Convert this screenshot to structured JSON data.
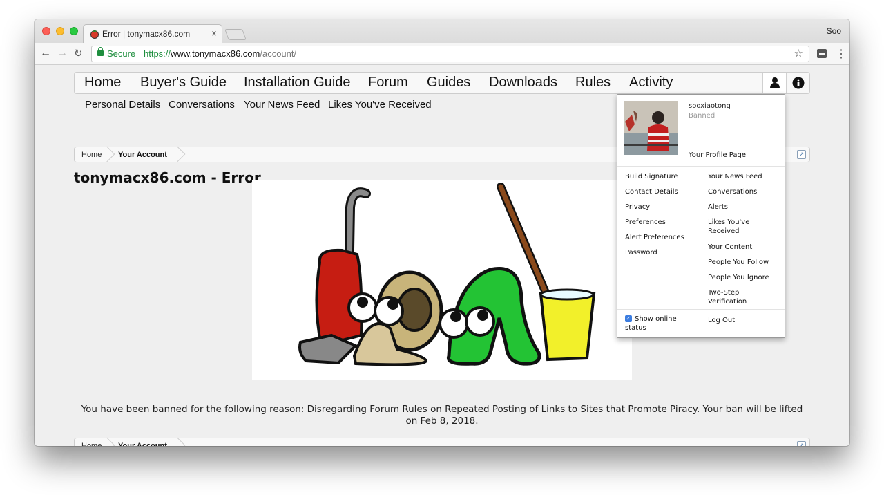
{
  "browser": {
    "tab_title": "Error | tonymacx86.com",
    "profile_name": "Soo",
    "address": {
      "security_label": "Secure",
      "url_scheme": "https://",
      "url_host": "www.tonymacx86.com",
      "url_path": "/account/"
    }
  },
  "navbar": {
    "items": [
      "Home",
      "Buyer's Guide",
      "Installation Guide",
      "Forum",
      "Guides",
      "Downloads",
      "Rules",
      "Activity"
    ]
  },
  "subnav": {
    "items": [
      "Personal Details",
      "Conversations",
      "Your News Feed",
      "Likes You've Received"
    ]
  },
  "breadcrumb": {
    "home": "Home",
    "current": "Your Account"
  },
  "page": {
    "title": "tonymacx86.com - Error",
    "message": "You have been banned for the following reason: Disregarding Forum Rules on Repeated Posting of Links to Sites that Promote Piracy. Your ban will be lifted on Feb 8, 2018."
  },
  "account_menu": {
    "username": "sooxiaotong",
    "status": "Banned",
    "profile_link": "Your Profile Page",
    "left_links": [
      "Build Signature",
      "Contact Details",
      "Privacy",
      "Preferences",
      "Alert Preferences",
      "Password"
    ],
    "right_links": [
      "Your News Feed",
      "Conversations",
      "Alerts",
      "Likes You've Received",
      "Your Content",
      "People You Follow",
      "People You Ignore",
      "Two-Step Verification"
    ],
    "show_online_status": "Show online status",
    "show_online_checked": true,
    "logout": "Log Out"
  },
  "colors": {
    "secure_green": "#1e8e3e",
    "check_blue": "#3c7de0"
  }
}
